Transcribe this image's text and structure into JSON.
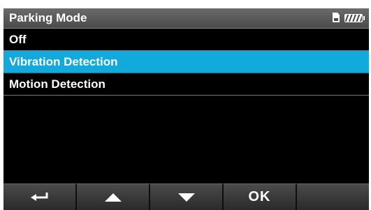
{
  "header": {
    "title": "Parking Mode",
    "status_icons": [
      "sd-card-icon",
      "battery-icon"
    ]
  },
  "menu": {
    "items": [
      {
        "label": "Off",
        "selected": false
      },
      {
        "label": "Vibration Detection",
        "selected": true
      },
      {
        "label": "Motion Detection",
        "selected": false
      }
    ]
  },
  "footer": {
    "buttons": [
      {
        "icon": "return-icon"
      },
      {
        "icon": "arrow-up-icon"
      },
      {
        "icon": "arrow-down-icon"
      },
      {
        "label": "OK"
      },
      {
        "icon": ""
      }
    ]
  },
  "colors": {
    "selected_background": "#12a9dc",
    "screen_background": "#000000",
    "title_bar": "#555555"
  }
}
